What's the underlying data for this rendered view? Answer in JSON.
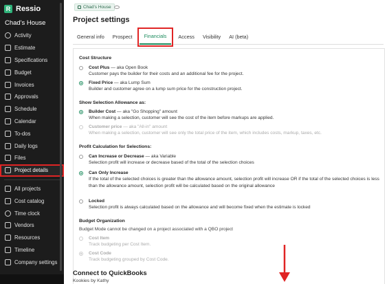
{
  "app": {
    "brand": "Ressio",
    "project_name": "Chad's House"
  },
  "sidebar": {
    "items": [
      {
        "label": "Activity",
        "icon": "activity-icon"
      },
      {
        "label": "Estimate",
        "icon": "estimate-icon"
      },
      {
        "label": "Specifications",
        "icon": "specifications-icon"
      },
      {
        "label": "Budget",
        "icon": "budget-icon"
      },
      {
        "label": "Invoices",
        "icon": "invoices-icon"
      },
      {
        "label": "Approvals",
        "icon": "approvals-icon"
      },
      {
        "label": "Schedule",
        "icon": "schedule-icon"
      },
      {
        "label": "Calendar",
        "icon": "calendar-icon"
      },
      {
        "label": "To-dos",
        "icon": "todos-icon"
      },
      {
        "label": "Daily logs",
        "icon": "daily-logs-icon"
      },
      {
        "label": "Files",
        "icon": "files-icon"
      },
      {
        "label": "Project details",
        "icon": "wrench-icon",
        "active": true
      }
    ],
    "secondary": [
      {
        "label": "All projects",
        "icon": "all-projects-icon"
      },
      {
        "label": "Cost catalog",
        "icon": "cost-catalog-icon"
      },
      {
        "label": "Time clock",
        "icon": "clock-icon"
      },
      {
        "label": "Vendors",
        "icon": "vendors-icon"
      },
      {
        "label": "Resources",
        "icon": "resources-icon"
      },
      {
        "label": "Timeline",
        "icon": "timeline-icon"
      },
      {
        "label": "Company settings",
        "icon": "gear-icon"
      }
    ]
  },
  "breadcrumb": {
    "badge": "Chad's House"
  },
  "page": {
    "title": "Project settings"
  },
  "tabs": [
    "General info",
    "Prospect",
    "Financials",
    "Access",
    "Visibility",
    "AI (beta)"
  ],
  "active_tab": "Financials",
  "financials": {
    "cost_structure": {
      "title": "Cost Structure",
      "options": [
        {
          "name": "Cost Plus",
          "aka": " — aka Open Book",
          "desc": "Customer pays the builder for their costs and an additional fee for the project.",
          "selected": false
        },
        {
          "name": "Fixed Price",
          "aka": " — aka Lump Sum",
          "desc": "Builder and customer agree on a lump sum price for the construction project.",
          "selected": true
        }
      ]
    },
    "allowance": {
      "title": "Show Selection Allowance as:",
      "options": [
        {
          "name": "Builder Cost",
          "aka": " — aka \"Go Shopping\" amount",
          "desc": "When making a selection, customer will see the cost of the item before markups are applied.",
          "selected": true
        },
        {
          "name": "Customer price",
          "aka": " — aka \"All-in\" amount",
          "desc": "When making a selection, customer will see only the total price of the item, which includes costs, markup, taxes, etc.",
          "selected": false,
          "disabled": true
        }
      ]
    },
    "profit": {
      "title": "Profit Calculation for Selections:",
      "options": [
        {
          "name": "Can Increase or Decrease",
          "aka": " — aka Variable",
          "desc": "Selection profit will increase or decrease based of the total of the selection choices",
          "selected": false
        },
        {
          "name": "Can Only Increase",
          "aka": "",
          "desc": "If the total of the selected choices is greater than the allowance amount, selection profit will increase OR if the total of the selected choices is less than the allowance amount, selection profit will be calculated based on the original allowance",
          "selected": true
        },
        {
          "name": "Locked",
          "aka": "",
          "desc": "Selection profit is always calculated based on the allowance and will become fixed when the estimate is locked",
          "selected": false
        }
      ]
    },
    "budget": {
      "title": "Budget Organization",
      "note": "Budget Mode cannot be changed on a project associated with a QBO project",
      "options": [
        {
          "name": "Cost Item",
          "desc": "Track budgeting per Cost Item.",
          "selected": false
        },
        {
          "name": "Cost Code",
          "desc": "Track budgeting grouped by Cost Code.",
          "selected": true
        }
      ]
    }
  },
  "connect": {
    "title": "Connect to QuickBooks",
    "subtitle": "Kookies by Kathy"
  },
  "colors": {
    "accent": "#1a8b5c",
    "highlight": "#e02424",
    "sidebar_bg": "#1c1c1c"
  }
}
